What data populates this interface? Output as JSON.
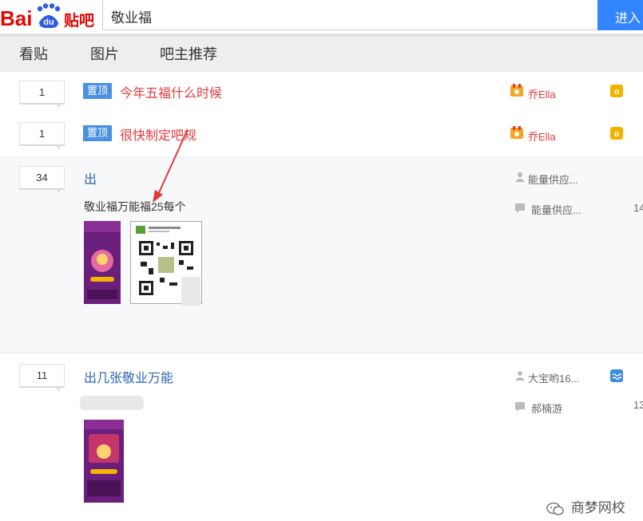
{
  "header": {
    "logo_text": "Bai贴吧",
    "logo_du": "du",
    "search_value": "敬业福",
    "enter_label": "进入"
  },
  "tabs": [
    {
      "label": "看贴"
    },
    {
      "label": "图片"
    },
    {
      "label": "吧主推荐"
    }
  ],
  "threads": [
    {
      "count": "1",
      "badge": "置顶",
      "title": "今年五福什么时候",
      "author": "乔Ella"
    },
    {
      "count": "1",
      "badge": "置顶",
      "title": "很快制定吧规",
      "author": "乔Ella"
    },
    {
      "count": "34",
      "title": "出",
      "desc": "敬业福万能福25每个",
      "author": "能量供应...",
      "last_reply": "能量供应...",
      "side_num": "14"
    },
    {
      "count": "11",
      "title": "出几张敬业万能",
      "author": "大宝哟16...",
      "last_reply": "郝楠游",
      "side_num": "13"
    }
  ],
  "watermark": "商梦网校",
  "colors": {
    "accent": "#3385ff",
    "badge": "#4a90e2",
    "title_red": "#e4393c",
    "title_blue": "#2d64b3"
  }
}
